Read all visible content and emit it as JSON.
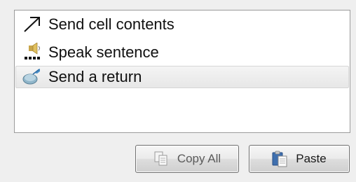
{
  "list": {
    "items": [
      {
        "label": "Send cell contents",
        "icon": "diagonal-arrow-icon"
      },
      {
        "label": "Speak sentence",
        "icon": "speaker-icon"
      },
      {
        "label": "Send a return",
        "icon": "return-send-icon",
        "selected": true
      }
    ]
  },
  "buttons": {
    "copy_all_label": "Copy All",
    "paste_label": "Paste"
  }
}
